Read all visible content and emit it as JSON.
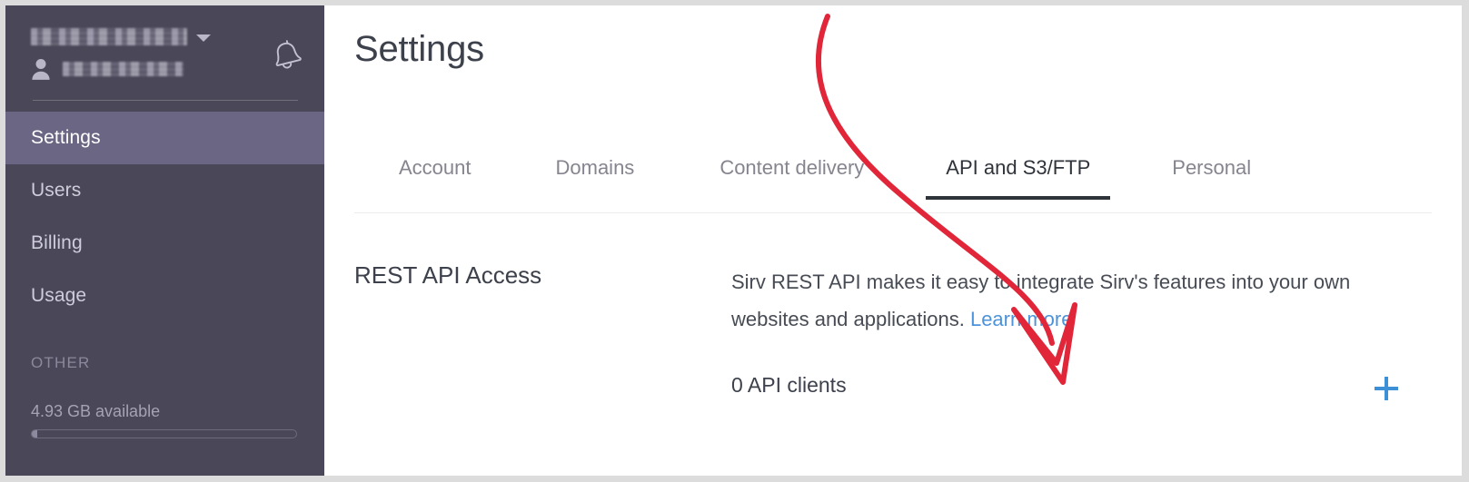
{
  "window": {
    "border_color": "#dcdcdc"
  },
  "sidebar": {
    "background_color": "#4a4758",
    "account_selector": {
      "name_redacted": "",
      "chevron_icon": "chevron-down-icon"
    },
    "user": {
      "icon": "person-icon",
      "name_redacted": ""
    },
    "notifications_icon": "bell-icon",
    "items": [
      {
        "label": "Settings",
        "active": true
      },
      {
        "label": "Users",
        "active": false
      },
      {
        "label": "Billing",
        "active": false
      },
      {
        "label": "Usage",
        "active": false
      }
    ],
    "active_item_color": "#6b6684",
    "other_section_label": "OTHER",
    "storage": {
      "text": "4.93 GB available",
      "percent_used": 2
    }
  },
  "header": {
    "title": "Settings"
  },
  "tabs": [
    {
      "label": "Account",
      "active": false
    },
    {
      "label": "Domains",
      "active": false
    },
    {
      "label": "Content delivery",
      "active": false
    },
    {
      "label": "API and S3/FTP",
      "active": true
    },
    {
      "label": "Personal",
      "active": false
    }
  ],
  "main": {
    "section_title": "REST API Access",
    "description_part1": "Sirv REST API makes it easy to integrate Sirv's features into your own websites and applications.",
    "learn_more_label": "Learn more",
    "learn_more_color": "#4d93d9",
    "clients_count_label": "0 API clients",
    "add_client_icon": "plus-icon",
    "add_client_color": "#3d8fd6"
  },
  "annotation": {
    "type": "curved-arrow",
    "color": "#e02638",
    "points_to": "add-client-button"
  }
}
